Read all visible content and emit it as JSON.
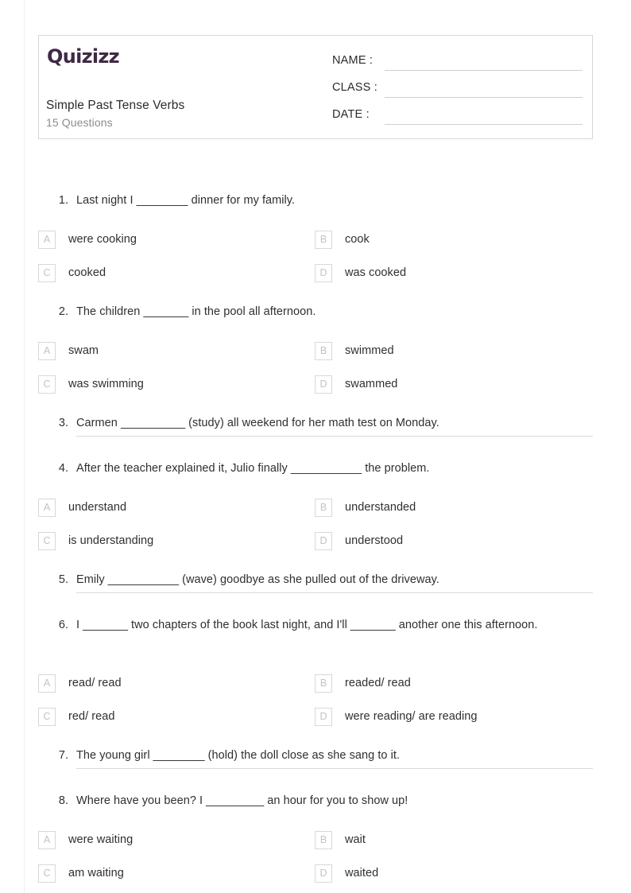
{
  "brand": {
    "logo_text": "Quizizz",
    "logo_color": "#3f2a45"
  },
  "header": {
    "title": "Simple Past Tense Verbs",
    "subtitle": "15 Questions",
    "meta_fields": [
      {
        "label": "NAME :"
      },
      {
        "label": "CLASS :"
      },
      {
        "label": "DATE  :"
      }
    ]
  },
  "questions": [
    {
      "number": "1.",
      "text": "Last night I ________ dinner for my family.",
      "type": "multiple-choice",
      "options": [
        {
          "letter": "A",
          "text": "were cooking"
        },
        {
          "letter": "B",
          "text": "cook"
        },
        {
          "letter": "C",
          "text": "cooked"
        },
        {
          "letter": "D",
          "text": "was cooked"
        }
      ]
    },
    {
      "number": "2.",
      "text": "The children _______ in the pool all afternoon.",
      "type": "multiple-choice",
      "options": [
        {
          "letter": "A",
          "text": "swam"
        },
        {
          "letter": "B",
          "text": "swimmed"
        },
        {
          "letter": "C",
          "text": "was swimming"
        },
        {
          "letter": "D",
          "text": "swammed"
        }
      ]
    },
    {
      "number": "3.",
      "text": "Carmen __________ (study) all weekend for her math test on Monday.",
      "type": "fill-in-the-blank",
      "options": []
    },
    {
      "number": "4.",
      "text": "After the teacher explained it, Julio finally ___________ the problem.",
      "type": "multiple-choice",
      "options": [
        {
          "letter": "A",
          "text": "understand"
        },
        {
          "letter": "B",
          "text": "understanded"
        },
        {
          "letter": "C",
          "text": "is understanding"
        },
        {
          "letter": "D",
          "text": "understood"
        }
      ]
    },
    {
      "number": "5.",
      "text": "Emily ___________ (wave) goodbye as she pulled out of the driveway.",
      "type": "fill-in-the-blank",
      "options": []
    },
    {
      "number": "6.",
      "text": "I _______ two chapters of the book last night, and I'll _______ another one this afternoon.",
      "type": "multiple-choice",
      "options": [
        {
          "letter": "A",
          "text": "read/ read"
        },
        {
          "letter": "B",
          "text": "readed/ read"
        },
        {
          "letter": "C",
          "text": "red/ read"
        },
        {
          "letter": "D",
          "text": "were reading/ are reading"
        }
      ]
    },
    {
      "number": "7.",
      "text": "The young girl ________ (hold) the doll close as she sang to it.",
      "type": "fill-in-the-blank",
      "options": []
    },
    {
      "number": "8.",
      "text": "Where have you been? I _________ an hour for you to show up!",
      "type": "multiple-choice",
      "options": [
        {
          "letter": "A",
          "text": "were waiting"
        },
        {
          "letter": "B",
          "text": "wait"
        },
        {
          "letter": "C",
          "text": "am waiting"
        },
        {
          "letter": "D",
          "text": "waited"
        }
      ]
    }
  ],
  "layout": {
    "question_tops": [
      242,
      382,
      522,
      579,
      719,
      776,
      940,
      997
    ],
    "option_row_tops": [
      [
        290,
        332
      ],
      [
        430,
        472
      ],
      [],
      [
        627,
        669
      ],
      [],
      [
        848,
        890
      ],
      [],
      [
        1045,
        1087
      ]
    ],
    "answer_rule_tops": [
      0,
      0,
      548,
      0,
      745,
      0,
      966,
      0
    ]
  }
}
